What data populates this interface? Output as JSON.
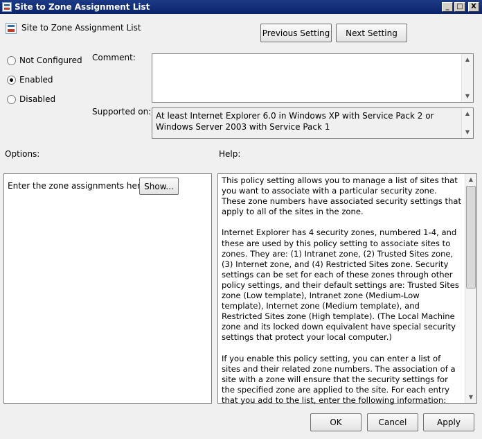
{
  "window": {
    "title": "Site to Zone Assignment List",
    "minimize_glyph": "_",
    "maximize_glyph": "□",
    "close_glyph": "X"
  },
  "header": {
    "setting_title": "Site to Zone Assignment List",
    "icon": "policy-setting-icon"
  },
  "nav": {
    "previous_label": "Previous Setting",
    "next_label": "Next Setting"
  },
  "state": {
    "options": [
      {
        "label": "Not Configured",
        "selected": false
      },
      {
        "label": "Enabled",
        "selected": true
      },
      {
        "label": "Disabled",
        "selected": false
      }
    ]
  },
  "comment": {
    "label": "Comment:",
    "value": ""
  },
  "supported": {
    "label": "Supported on:",
    "value": "At least Internet Explorer 6.0 in Windows XP with Service Pack 2 or Windows Server 2003 with Service Pack 1"
  },
  "options_panel": {
    "label": "Options:",
    "prompt": "Enter the zone assignments here.",
    "show_label": "Show..."
  },
  "help_panel": {
    "label": "Help:",
    "paragraphs": [
      "This policy setting allows you to manage a list of sites that you want to associate with a particular security zone. These zone numbers have associated security settings that apply to all of the sites in the zone.",
      "Internet Explorer has 4 security zones, numbered 1-4, and these are used by this policy setting to associate sites to zones. They are: (1) Intranet zone, (2) Trusted Sites zone, (3) Internet zone, and (4) Restricted Sites zone. Security settings can be set for each of these zones through other policy settings, and their default settings are: Trusted Sites zone (Low template), Intranet zone (Medium-Low template), Internet zone (Medium template), and Restricted Sites zone (High template). (The Local Machine zone and its locked down equivalent have special security settings that protect your local computer.)",
      "If you enable this policy setting, you can enter a list of sites and their related zone numbers. The association of a site with a zone will ensure that the security settings for the specified zone are applied to the site.  For each entry that you add to the list, enter the following information:"
    ]
  },
  "footer": {
    "ok_label": "OK",
    "cancel_label": "Cancel",
    "apply_label": "Apply"
  },
  "colors": {
    "titlebar": "#0a246a",
    "dialog_bg": "#f0f0f0",
    "field_bg": "#ffffff"
  }
}
